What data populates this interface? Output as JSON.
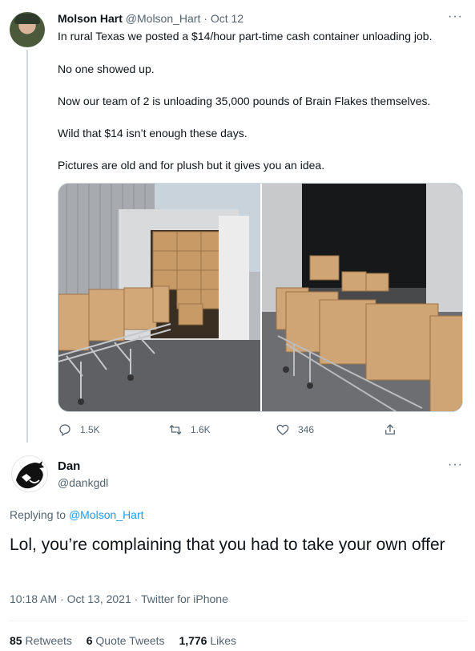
{
  "tweet": {
    "author_name": "Molson Hart",
    "author_handle": "@Molson_Hart",
    "separator": "·",
    "date": "Oct 12",
    "more_label": "···",
    "lines": [
      "In rural Texas we posted a $14/hour part-time cash container unloading job.",
      "No one showed up.",
      "Now our team of 2 is unloading 35,000 pounds of Brain Flakes themselves.",
      "Wild that $14 isn’t enough these days.",
      "Pictures are old and for plush but it gives you an idea."
    ],
    "actions": {
      "reply_count": "1.5K",
      "retweet_count": "1.6K",
      "like_count": "346"
    }
  },
  "reply": {
    "author_name": "Dan",
    "author_handle": "@dankgdl",
    "more_label": "···",
    "replying_prefix": "Replying to",
    "replying_to": "@Molson_Hart",
    "text": "Lol, you’re complaining that you had to take your own offer",
    "timestamp": "10:18 AM · Oct 13, 2021 · Twitter for iPhone",
    "stats": {
      "retweets_count": "85",
      "retweets_label": "Retweets",
      "quotes_count": "6",
      "quotes_label": "Quote Tweets",
      "likes_count": "1,776",
      "likes_label": "Likes"
    }
  },
  "icons": {
    "reply": "comment-icon",
    "retweet": "retweet-icon",
    "like": "heart-icon",
    "share": "share-icon"
  },
  "colors": {
    "link": "#1d9bf0",
    "muted": "#536471",
    "text": "#0f1419"
  }
}
